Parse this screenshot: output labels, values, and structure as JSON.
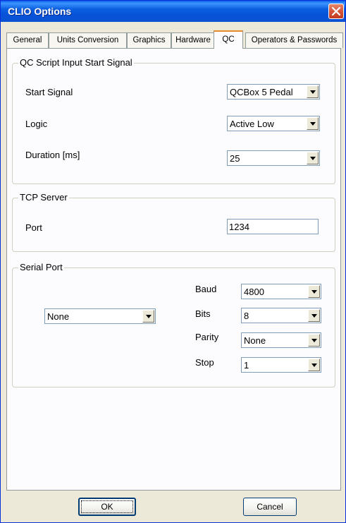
{
  "window": {
    "title": "CLIO Options"
  },
  "tabs": [
    {
      "label": "General"
    },
    {
      "label": "Units Conversion"
    },
    {
      "label": "Graphics"
    },
    {
      "label": "Hardware"
    },
    {
      "label": "QC"
    },
    {
      "label": "Operators & Passwords"
    }
  ],
  "active_tab": "QC",
  "qc_script": {
    "title": "QC Script Input Start Signal",
    "start_signal": {
      "label": "Start Signal",
      "value": "QCBox 5 Pedal"
    },
    "logic": {
      "label": "Logic",
      "value": "Active Low"
    },
    "duration": {
      "label": "Duration [ms]",
      "value": "25"
    }
  },
  "tcp_server": {
    "title": "TCP Server",
    "port": {
      "label": "Port",
      "value": "1234"
    }
  },
  "serial_port": {
    "title": "Serial Port",
    "port_select": {
      "value": "None"
    },
    "baud": {
      "label": "Baud",
      "value": "4800"
    },
    "bits": {
      "label": "Bits",
      "value": "8"
    },
    "parity": {
      "label": "Parity",
      "value": "None"
    },
    "stop": {
      "label": "Stop",
      "value": "1"
    }
  },
  "buttons": {
    "ok": "OK",
    "cancel": "Cancel"
  },
  "icons": {
    "close": "close-icon",
    "dropdown": "chevron-down-icon"
  },
  "colors": {
    "titlebar": "#0A5CE8",
    "face": "#ECE9D8",
    "active_tab_accent": "#E68B2C"
  }
}
